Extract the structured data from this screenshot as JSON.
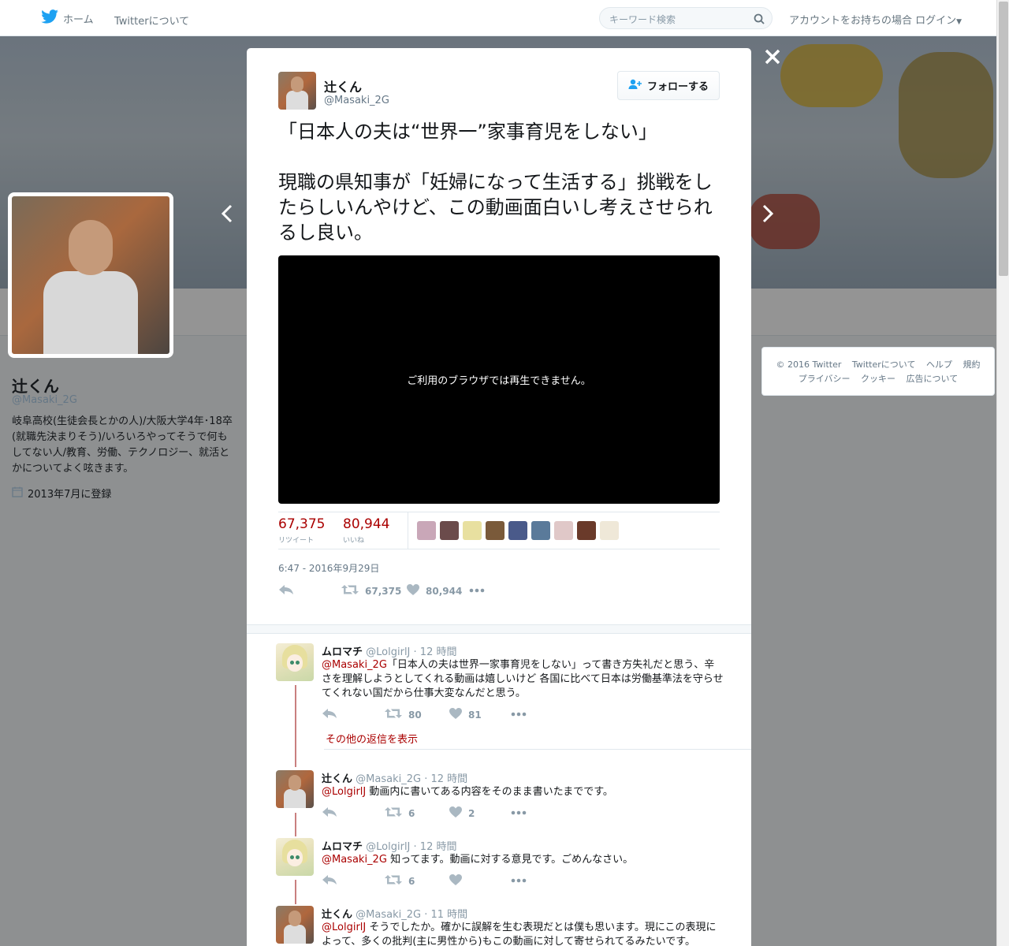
{
  "topbar": {
    "home": "ホーム",
    "about": "Twitterについて",
    "search_placeholder": "キーワード検索",
    "login": "アカウントをお持ちの場合 ログイン"
  },
  "profile": {
    "name": "辻くん",
    "handle": "@Masaki_2G",
    "bio": "岐阜高校(生徒会長とかの人)/大阪大学4年･18卒(就職先決まりそう)/いろいろやってそうで何もしてない人/教育、労働、テクノロジー、就活とかについてよく呟きます。",
    "joined": "2013年7月に登録"
  },
  "footer": {
    "row1": [
      "© 2016 Twitter",
      "Twitterについて",
      "ヘルプ",
      "規約"
    ],
    "row2": [
      "プライバシー",
      "クッキー",
      "広告について"
    ]
  },
  "tweet": {
    "name": "辻くん",
    "handle": "@Masaki_2G",
    "follow_label": "フォローする",
    "text": "「日本人の夫は“世界一”家事育児をしない」\n\n現職の県知事が「妊婦になって生活する」挑戦をしたらしいんやけど、この動画面白いし考えさせられるし良い。",
    "video_message": "ご利用のブラウザでは再生できません。",
    "retweets": "67,375",
    "retweets_label": "リツイート",
    "likes": "80,944",
    "likes_label": "いいね",
    "timestamp": "6:47 - 2016年9月29日",
    "action_retweets": "67,375",
    "action_likes": "80,944"
  },
  "liker_colors": [
    "#c9a7b8",
    "#6b4b4b",
    "#e8e0a0",
    "#7a5a3a",
    "#4a5a8a",
    "#5a7a9a",
    "#e0c8c8",
    "#6a3a2a",
    "#efe8d8"
  ],
  "replies": [
    {
      "name": "ムロマチ",
      "handle": "@LolgirlJ",
      "time": "· 12 時間",
      "mention": "@Masaki_2G",
      "text": "「日本人の夫は世界一家事育児をしない」って書き方失礼だと思う、辛さを理解しようとしてくれる動画は嬉しいけど 各国に比べて日本は労働基準法を守らせてくれない国だから仕事大変なんだと思う。",
      "retweets": "80",
      "likes": "81"
    },
    {
      "name": "辻くん",
      "handle": "@Masaki_2G",
      "time": "· 12 時間",
      "mention": "@LolgirlJ",
      "text": "動画内に書いてある内容をそのまま書いたまでです。",
      "retweets": "6",
      "likes": "2"
    },
    {
      "name": "ムロマチ",
      "handle": "@LolgirlJ",
      "time": "· 12 時間",
      "mention": "@Masaki_2G",
      "text": "知ってます。動画に対する意見です。ごめんなさい。",
      "retweets": "6",
      "likes": ""
    },
    {
      "name": "辻くん",
      "handle": "@Masaki_2G",
      "time": "· 11 時間",
      "mention": "@LolgirlJ",
      "text": "そうでしたか。確かに誤解を生む表現だとは僕も思います。現にこの表現によって、多くの批判(主に男性から)もこの動画に対して寄せられてるみたいです。",
      "retweets": "",
      "likes": ""
    }
  ],
  "more_replies": "その他の返信を表示"
}
